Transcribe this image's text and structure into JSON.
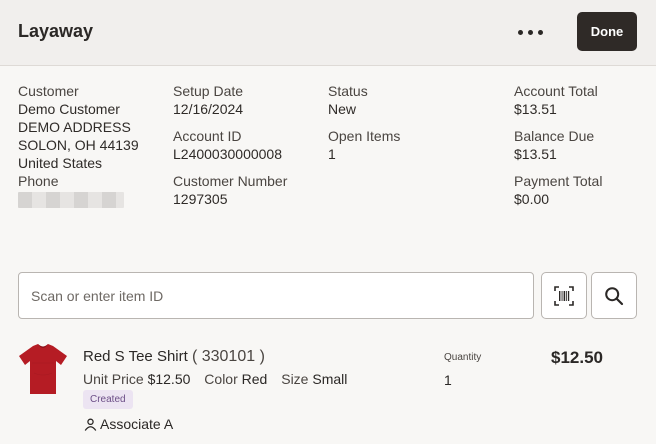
{
  "header": {
    "title": "Layaway",
    "more_icon": "more-horizontal-icon",
    "done_label": "Done"
  },
  "customer": {
    "label": "Customer",
    "name": "Demo Customer",
    "address_line1": "DEMO ADDRESS",
    "address_line2": "SOLON, OH 44139",
    "country": "United States",
    "phone_label": "Phone"
  },
  "setup": {
    "date_label": "Setup Date",
    "date_value": "12/16/2024",
    "account_id_label": "Account ID",
    "account_id_value": "L2400030000008",
    "customer_number_label": "Customer Number",
    "customer_number_value": "1297305"
  },
  "status": {
    "status_label": "Status",
    "status_value": "New",
    "open_items_label": "Open Items",
    "open_items_value": "1"
  },
  "totals": {
    "account_total_label": "Account Total",
    "account_total_value": "$13.51",
    "balance_due_label": "Balance Due",
    "balance_due_value": "$13.51",
    "payment_total_label": "Payment Total",
    "payment_total_value": "$0.00"
  },
  "search": {
    "placeholder": "Scan or enter item ID",
    "barcode_icon": "barcode-scan-icon",
    "search_icon": "search-icon"
  },
  "item": {
    "name": "Red S Tee Shirt",
    "code": "( 330101 )",
    "unit_price_label": "Unit Price",
    "unit_price_value": "$12.50",
    "color_label": "Color",
    "color_value": "Red",
    "size_label": "Size",
    "size_value": "Small",
    "status_badge": "Created",
    "associate": "Associate A",
    "quantity_label": "Quantity",
    "quantity_value": "1",
    "price": "$12.50",
    "image_icon": "tshirt-image"
  },
  "colors": {
    "done_bg": "#2f2a27",
    "badge_bg": "#ece4f2",
    "badge_text": "#6c4e87",
    "shirt": "#b51c24"
  }
}
